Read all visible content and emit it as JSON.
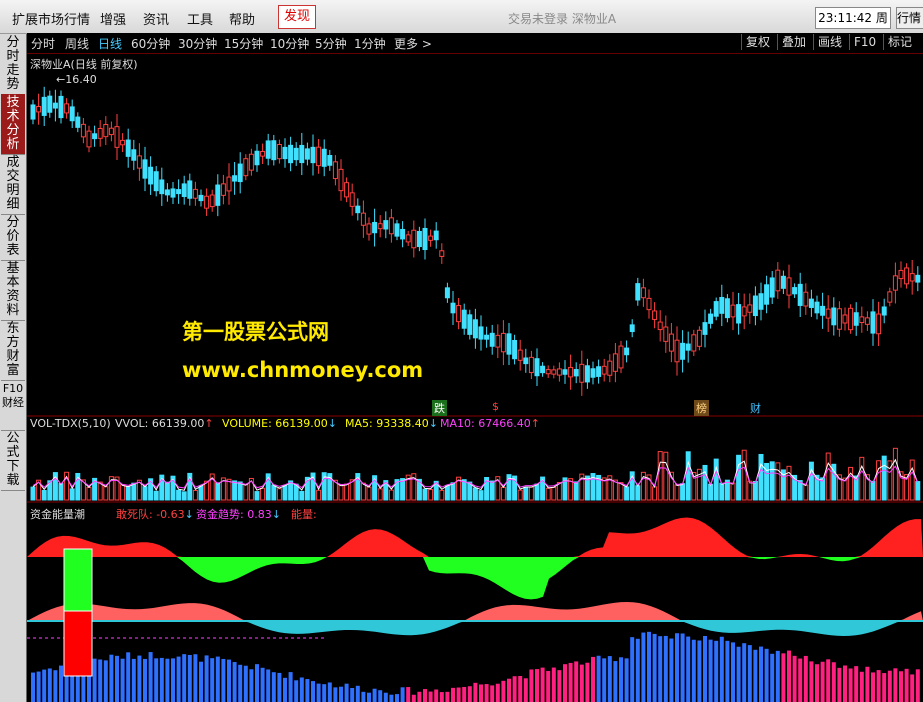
{
  "menubar": {
    "items": [
      "扩展市场行情",
      "增强",
      "资讯",
      "工具",
      "帮助"
    ],
    "discover": "发现",
    "status": "交易未登录    深物业A",
    "clock": "23:11:42 周二",
    "trade": "行情"
  },
  "sidebar": {
    "tabs": [
      "分时走势",
      "技术分析",
      "成交明细",
      "分价表",
      "基本资料",
      "东方财富",
      "F10财经",
      "公式下载"
    ]
  },
  "toolbar": {
    "periods": [
      "分时",
      "周线",
      "日线",
      "60分钟",
      "30分钟",
      "15分钟",
      "10分钟",
      "5分钟",
      "1分钟",
      "更多 >"
    ],
    "buttons": [
      "复权",
      "叠加",
      "画线",
      "F10",
      "标记"
    ]
  },
  "chart": {
    "title": "深物业A(日线 前复权)",
    "high_label": "16.40",
    "markers": {
      "die": "跌",
      "s": "$",
      "bang": "榜",
      "cai": "财"
    },
    "watermark_cn": "第一股票公式网",
    "watermark_url": "www.chnmoney.com",
    "vol_header": {
      "name": "VOL-TDX(5,10)",
      "vvol": "VVOL: 66139.00",
      "volume": "VOLUME: 66139.00",
      "ma5": "MA5: 93338.40",
      "ma10": "MA10: 67466.40"
    },
    "fund_header": {
      "name": "资金能量潮",
      "dsd": "敢死队: -0.63",
      "trend": "资金趋势: 0.83",
      "energy": "能量:"
    },
    "colors": {
      "up": "#ff4040",
      "down": "#40e0ff",
      "ma5": "#ffffff",
      "ma10": "#ffff40",
      "green": "#20ff20"
    }
  }
}
